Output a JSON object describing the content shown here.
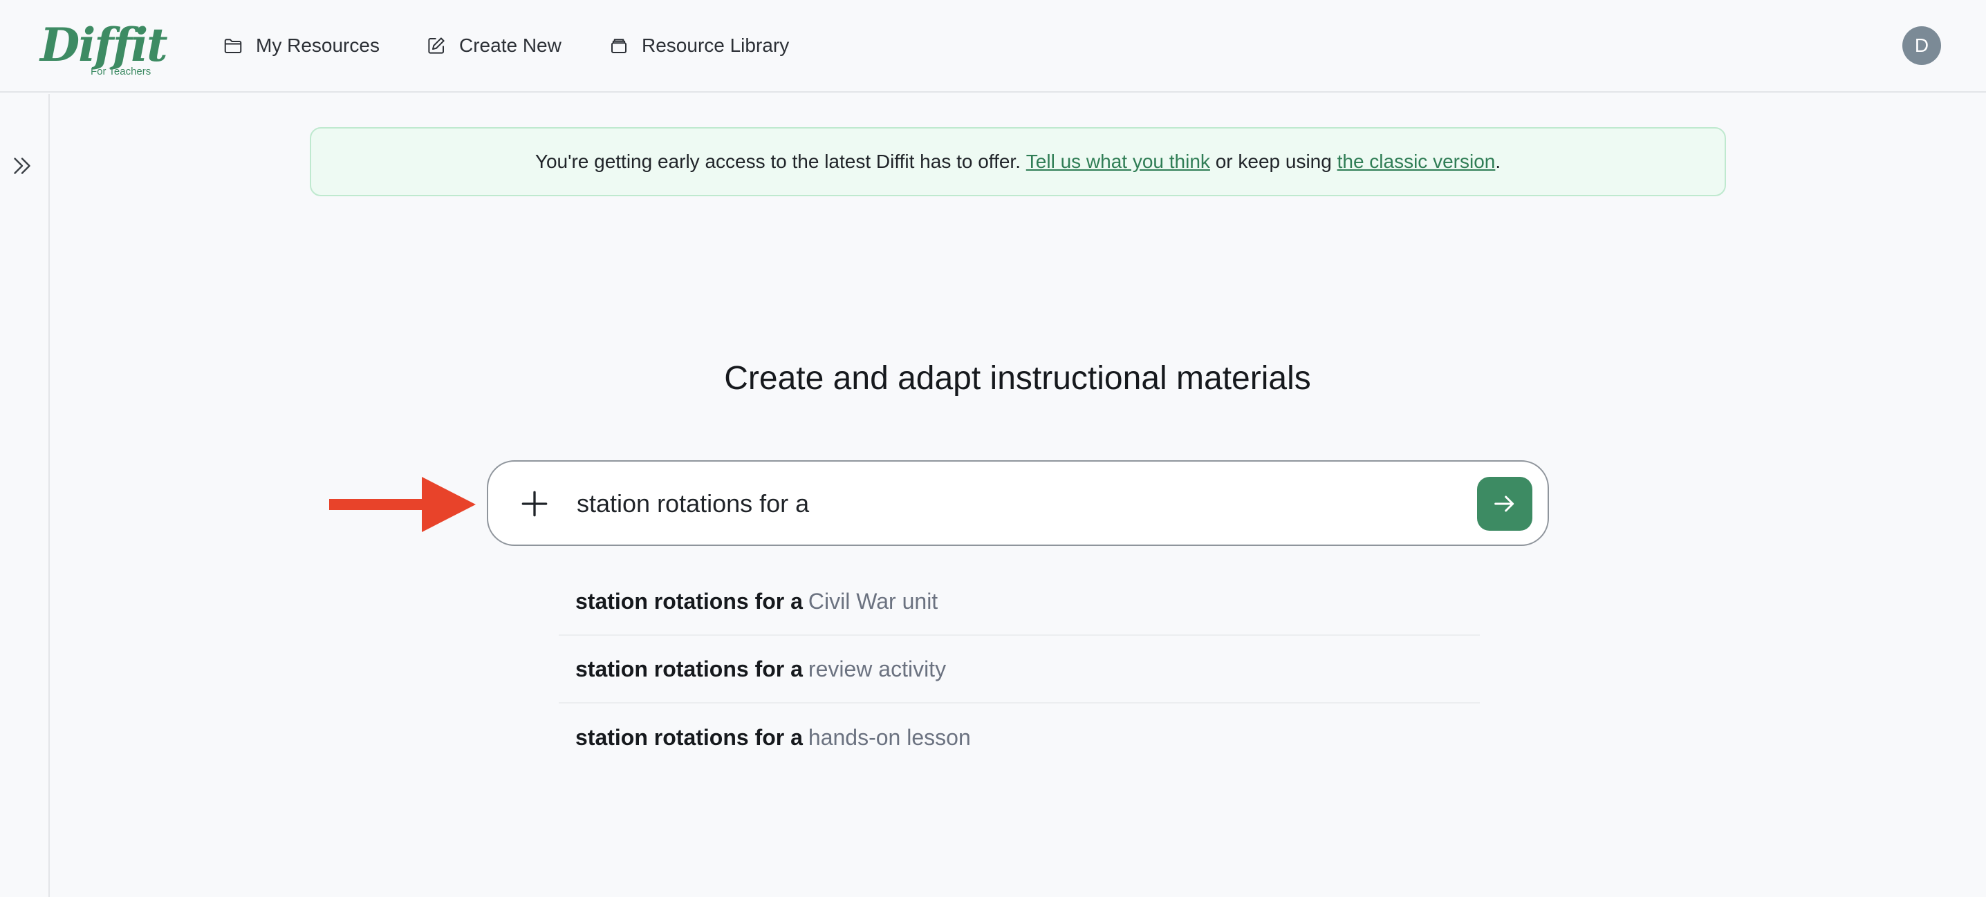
{
  "brand": {
    "name": "Diffit",
    "tagline": "For Teachers",
    "color": "#3d8b63"
  },
  "nav": {
    "my_resources": "My Resources",
    "create_new": "Create New",
    "resource_library": "Resource Library"
  },
  "user": {
    "avatar_initial": "D"
  },
  "banner": {
    "text_before": "You're getting early access to the latest Diffit has to offer. ",
    "feedback_link": "Tell us what you think",
    "text_middle": " or keep using ",
    "classic_link": "the classic version",
    "text_after": "."
  },
  "main": {
    "title": "Create and adapt instructional materials",
    "search": {
      "value": "station rotations for a"
    },
    "suggestions": [
      {
        "prefix": "station rotations for a",
        "completion": "Civil War unit"
      },
      {
        "prefix": "station rotations for a",
        "completion": "review activity"
      },
      {
        "prefix": "station rotations for a",
        "completion": "hands-on lesson"
      }
    ]
  },
  "colors": {
    "accent": "#3d8b63",
    "annotation_arrow": "#e8432a",
    "banner_bg": "#eefaf3"
  },
  "icons": [
    "folder-icon",
    "edit-icon",
    "library-icon",
    "chevrons-right-icon",
    "plus-icon",
    "arrow-right-icon"
  ]
}
